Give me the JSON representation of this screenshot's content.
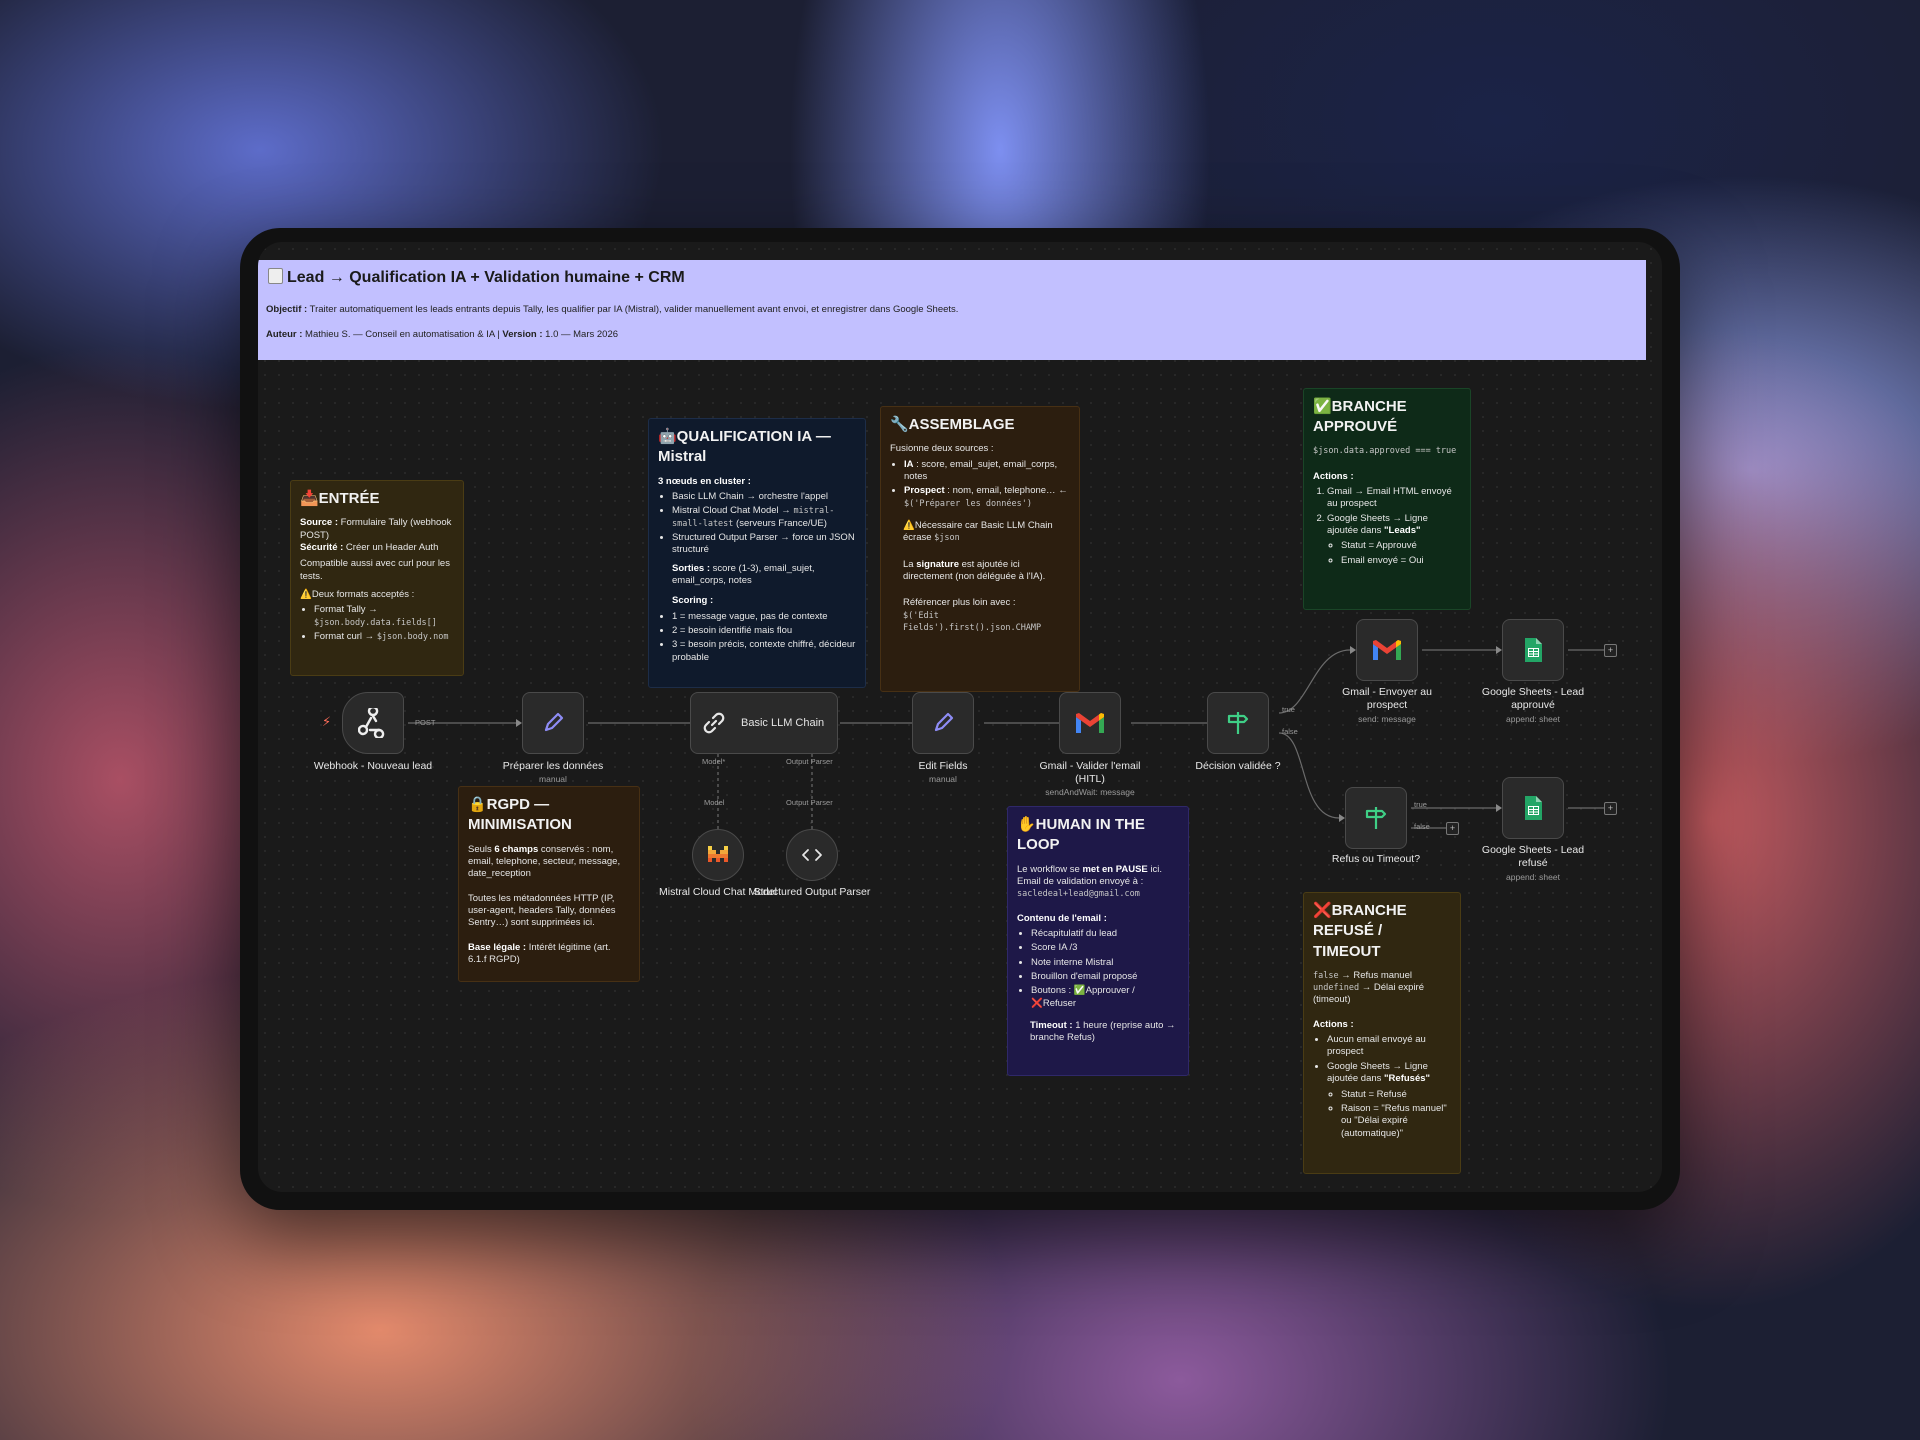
{
  "header": {
    "icon": "clipboard-icon",
    "title": "Lead → Qualification IA + Validation humaine + CRM",
    "objective_label": "Objectif :",
    "objective_text": " Traiter automatiquement les leads entrants depuis Tally, les qualifier par IA (Mistral), valider manuellement avant envoi, et enregistrer dans Google Sheets.",
    "author_label": "Auteur :",
    "author_text": " Mathieu S. — Conseil en automatisation & IA | ",
    "version_label": "Version :",
    "version_text": " 1.0 — Mars 2026"
  },
  "notes": {
    "entree": {
      "title": "📥ENTRÉE",
      "source_label": "Source :",
      "source_text": " Formulaire Tally (webhook POST)",
      "security_label": "Sécurité :",
      "security_text": " Créer un Header Auth",
      "compat": "Compatible aussi avec curl pour les tests.",
      "formats_title": "⚠️Deux formats acceptés :",
      "format1": "Format Tally → ",
      "format1_code": "$json.body.data.fields[]",
      "format2": "Format curl → ",
      "format2_code": "$json.body.nom"
    },
    "qualification": {
      "title": "🤖QUALIFICATION IA — Mistral",
      "cluster": "3 nœuds en cluster :",
      "item1": "Basic LLM Chain → orchestre l'appel",
      "item2": "Mistral Cloud Chat Model → ",
      "item2_code": "mistral-small-latest",
      "item2_tail": " (serveurs France/UE)",
      "item3": "Structured Output Parser → force un JSON structuré",
      "outputs_label": "Sorties :",
      "outputs_text": " score (1-3), email_sujet, email_corps, notes",
      "scoring_label": "Scoring :",
      "score1": "1 = message vague, pas de contexte",
      "score2": "2 = besoin identifié mais flou",
      "score3": "3 = besoin précis, contexte chiffré, décideur probable"
    },
    "assemblage": {
      "title": "🔧ASSEMBLAGE",
      "intro": "Fusionne deux sources :",
      "ia_label": "IA",
      "ia_text": " : score, email_sujet, email_corps, notes",
      "prospect_label": "Prospect",
      "prospect_text": " : nom, email, telephone… ← ",
      "prospect_code": "$('Préparer les données')",
      "warn": "⚠️Nécessaire car Basic LLM Chain écrase ",
      "warn_code": "$json",
      "sig_pre": "La ",
      "sig_bold": "signature",
      "sig_post": " est ajoutée ici directement (non déléguée à l'IA).",
      "ref": "Référencer plus loin avec :",
      "ref_code": "$('Edit Fields').first().json.CHAMP"
    },
    "approuve": {
      "title": "✅BRANCHE APPROUVÉ",
      "code": "$json.data.approved === true",
      "actions": "Actions :",
      "a1": "Gmail → Email HTML envoyé au prospect",
      "a2": "Google Sheets → Ligne ajoutée dans ",
      "a2_bold": "\"Leads\"",
      "s1": "Statut = Approuvé",
      "s2": "Email envoyé = Oui"
    },
    "rgpd": {
      "title": "🔒RGPD — MINIMISATION",
      "p1_pre": "Seuls ",
      "p1_bold": "6 champs",
      "p1_post": " conservés : nom, email, telephone, secteur, message, date_reception",
      "p2": "Toutes les métadonnées HTTP (IP, user-agent, headers Tally, données Sentry…) sont supprimées ici.",
      "legal_label": "Base légale :",
      "legal_text": " Intérêt légitime (art. 6.1.f RGPD)"
    },
    "hitl": {
      "title": "✋HUMAN IN THE LOOP",
      "p1_pre": "Le workflow se ",
      "p1_bold": "met en PAUSE",
      "p1_post": " ici. Email de validation envoyé à :",
      "email": "sacledeal+lead@gmail.com",
      "content_label": "Contenu de l'email :",
      "c1": "Récapitulatif du lead",
      "c2": "Score IA /3",
      "c3": "Note interne Mistral",
      "c4": "Brouillon d'email proposé",
      "c5": "Boutons : ✅Approuver / ❌Refuser",
      "timeout_label": "Timeout :",
      "timeout_text": " 1 heure (reprise auto → branche Refus)"
    },
    "refuse": {
      "title": "❌BRANCHE REFUSÉ / TIMEOUT",
      "l1_code": "false",
      "l1_text": " → Refus manuel",
      "l2_code": "undefined",
      "l2_text": " → Délai expiré (timeout)",
      "actions": "Actions :",
      "a1": "Aucun email envoyé au prospect",
      "a2": "Google Sheets → Ligne ajoutée dans ",
      "a2_bold": "\"Refusés\"",
      "s1": "Statut = Refusé",
      "s2": "Raison = \"Refus manuel\" ou \"Délai expiré (automatique)\""
    }
  },
  "nodes": {
    "webhook": {
      "label": "Webhook - Nouveau lead",
      "icon": "webhook-icon",
      "port": "POST"
    },
    "prepare": {
      "label": "Préparer les données",
      "sub": "manual",
      "icon": "pencil-icon"
    },
    "llm": {
      "label": "Basic LLM Chain",
      "icon": "link-icon",
      "port_model": "Model*",
      "port_parser": "Output Parser"
    },
    "mistral": {
      "label": "Mistral Cloud Chat Model",
      "icon": "mistral-icon",
      "port": "Model"
    },
    "parser": {
      "label": "Structured Output Parser",
      "icon": "code-brackets-icon",
      "port": "Output Parser"
    },
    "edit": {
      "label": "Edit Fields",
      "sub": "manual",
      "icon": "pencil-icon"
    },
    "gmail_validate": {
      "label": "Gmail - Valider l'email (HITL)",
      "sub": "sendAndWait: message",
      "icon": "gmail-icon"
    },
    "decision": {
      "label": "Décision validée ?",
      "icon": "signpost-icon",
      "port_true": "true",
      "port_false": "false"
    },
    "gmail_send": {
      "label": "Gmail - Envoyer au prospect",
      "sub": "send: message",
      "icon": "gmail-icon"
    },
    "sheets_ok": {
      "label": "Google Sheets - Lead approuvé",
      "sub": "append: sheet",
      "icon": "sheets-icon"
    },
    "refus": {
      "label": "Refus ou Timeout?",
      "icon": "signpost-icon",
      "port_true": "true",
      "port_false": "false"
    },
    "sheets_ko": {
      "label": "Google Sheets - Lead refusé",
      "sub": "append: sheet",
      "icon": "sheets-icon"
    }
  },
  "colors": {
    "header": "#c2c0ff",
    "canvas": "#1a1a1a",
    "pencil": "#8e8cf5",
    "signpost": "#3fcf86",
    "trigger": "#ff6d5a"
  }
}
